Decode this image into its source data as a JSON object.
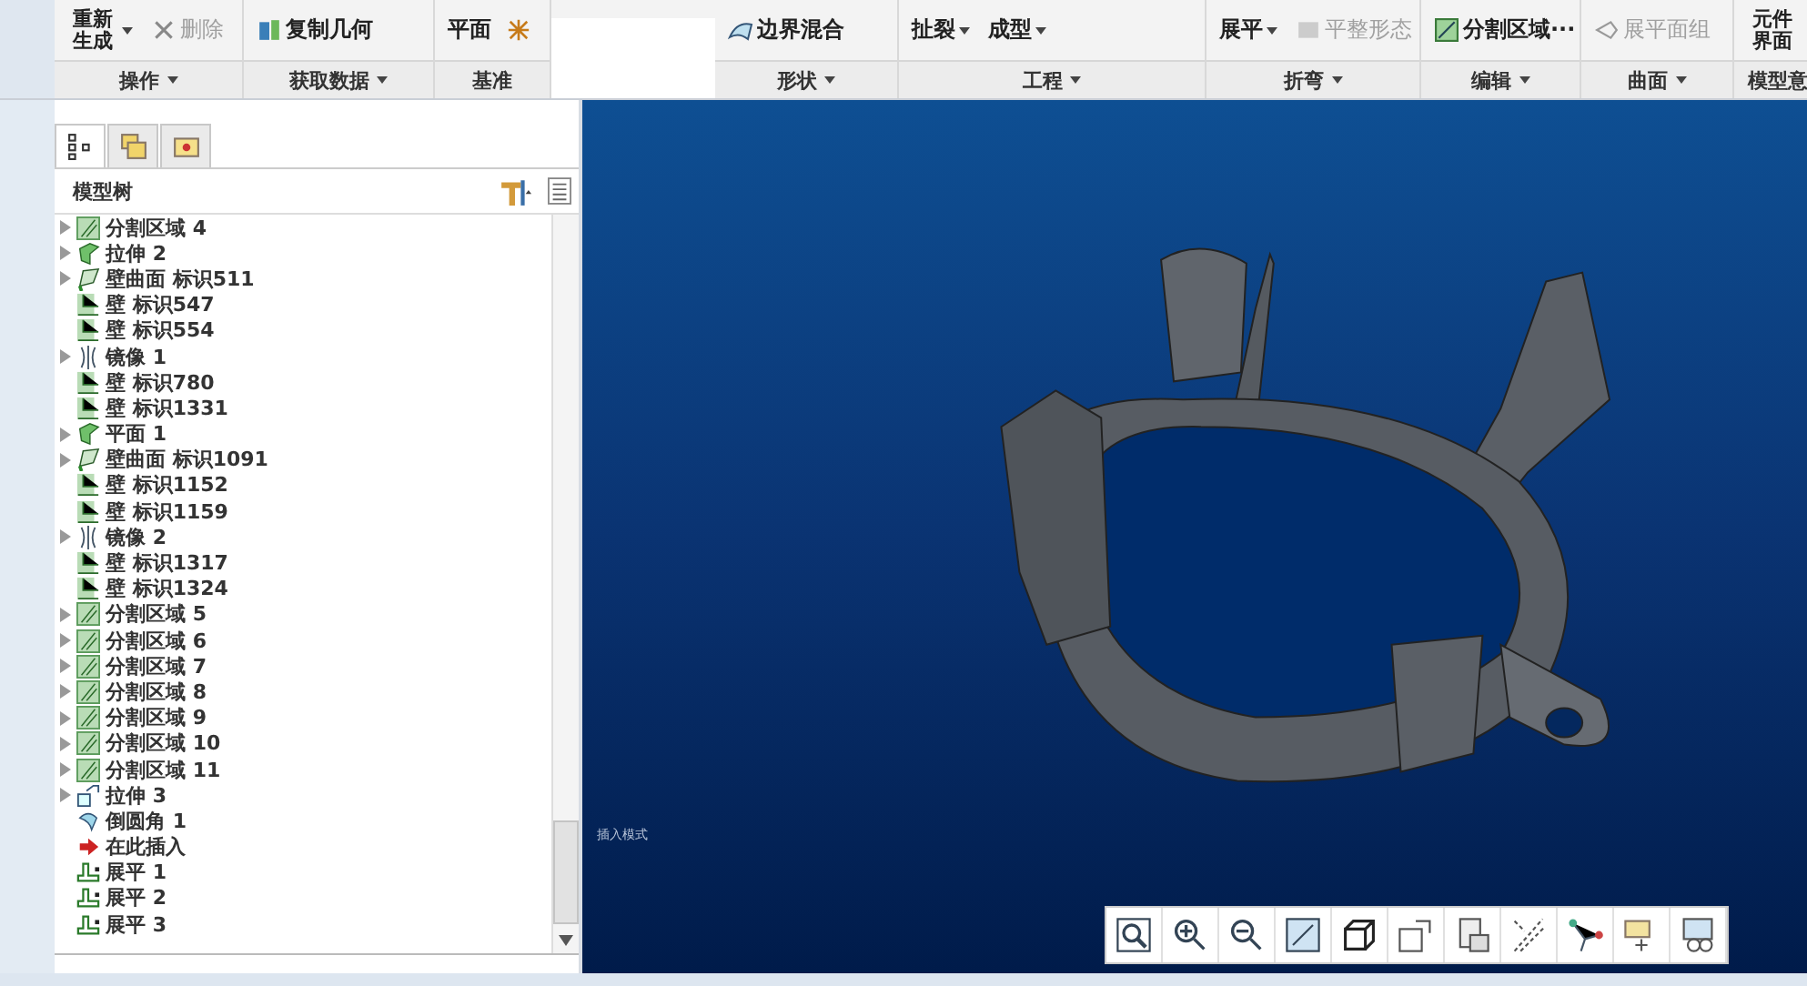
{
  "ribbon": {
    "groups": [
      {
        "label": "操作",
        "buttons": [
          {
            "label": "重新生成",
            "kind": "regen",
            "disabled": false
          },
          {
            "label": "删除",
            "kind": "delete",
            "disabled": true
          }
        ]
      },
      {
        "label": "获取数据",
        "buttons": [
          {
            "label": "复制几何",
            "kind": "copy",
            "disabled": false
          }
        ]
      },
      {
        "label": "基准",
        "buttons": [
          {
            "label": "平面",
            "kind": "text",
            "disabled": false
          },
          {
            "kind": "star"
          }
        ]
      },
      {
        "label": "形状",
        "buttons": [
          {
            "label": "边界混合",
            "kind": "blend",
            "disabled": false
          }
        ]
      },
      {
        "label": "工程",
        "buttons": [
          {
            "label": "扯裂",
            "kind": "drop",
            "disabled": false
          },
          {
            "label": "成型",
            "kind": "drop",
            "disabled": false
          }
        ]
      },
      {
        "label": "折弯",
        "buttons": [
          {
            "label": "展平",
            "kind": "drop",
            "disabled": false
          },
          {
            "label": "平整形态",
            "kind": "flat",
            "disabled": true
          }
        ]
      },
      {
        "label": "编辑",
        "buttons": [
          {
            "label": "分割区域···",
            "kind": "split",
            "disabled": false
          }
        ]
      },
      {
        "label": "曲面",
        "buttons": [
          {
            "label": "展平面组",
            "kind": "quilt",
            "disabled": true
          }
        ]
      },
      {
        "label": "模型意",
        "buttons": [
          {
            "label": "元件界面",
            "kind": "text",
            "disabled": false
          }
        ]
      }
    ]
  },
  "panel": {
    "tabs": [
      {
        "kind": "tree",
        "selected": true
      },
      {
        "kind": "layers",
        "selected": false
      },
      {
        "kind": "folder",
        "selected": false
      }
    ],
    "title": "模型树",
    "items": [
      {
        "label": "分割区域 4",
        "kind": "split",
        "expandable": true
      },
      {
        "label": "拉伸 2",
        "kind": "extrude",
        "expandable": true
      },
      {
        "label": "壁曲面 标识511",
        "kind": "surface",
        "expandable": true
      },
      {
        "label": "壁 标识547",
        "kind": "wall",
        "expandable": false
      },
      {
        "label": "壁 标识554",
        "kind": "wall",
        "expandable": false
      },
      {
        "label": "镜像 1",
        "kind": "mirror",
        "expandable": true
      },
      {
        "label": "壁 标识780",
        "kind": "wall",
        "expandable": false
      },
      {
        "label": "壁 标识1331",
        "kind": "wall",
        "expandable": false
      },
      {
        "label": "平面 1",
        "kind": "extrude",
        "expandable": true
      },
      {
        "label": "壁曲面 标识1091",
        "kind": "surface",
        "expandable": true
      },
      {
        "label": "壁 标识1152",
        "kind": "wall",
        "expandable": false
      },
      {
        "label": "壁 标识1159",
        "kind": "wall",
        "expandable": false
      },
      {
        "label": "镜像 2",
        "kind": "mirror",
        "expandable": true
      },
      {
        "label": "壁 标识1317",
        "kind": "wall",
        "expandable": false
      },
      {
        "label": "壁 标识1324",
        "kind": "wall",
        "expandable": false
      },
      {
        "label": "分割区域 5",
        "kind": "split",
        "expandable": true
      },
      {
        "label": "分割区域 6",
        "kind": "split",
        "expandable": true
      },
      {
        "label": "分割区域 7",
        "kind": "split",
        "expandable": true
      },
      {
        "label": "分割区域 8",
        "kind": "split",
        "expandable": true
      },
      {
        "label": "分割区域 9",
        "kind": "split",
        "expandable": true
      },
      {
        "label": "分割区域 10",
        "kind": "split",
        "expandable": true
      },
      {
        "label": "分割区域 11",
        "kind": "split",
        "expandable": true
      },
      {
        "label": "拉伸 3",
        "kind": "cut",
        "expandable": true
      },
      {
        "label": "倒圆角 1",
        "kind": "round",
        "expandable": false
      },
      {
        "label": "在此插入",
        "kind": "insert",
        "expandable": false
      },
      {
        "label": "展平 1",
        "kind": "unbend",
        "expandable": false
      },
      {
        "label": "展平 2",
        "kind": "unbend",
        "expandable": false
      },
      {
        "label": "展平 3",
        "kind": "unbend",
        "expandable": false
      }
    ]
  },
  "viewport": {
    "mode_text": "插入模式"
  }
}
